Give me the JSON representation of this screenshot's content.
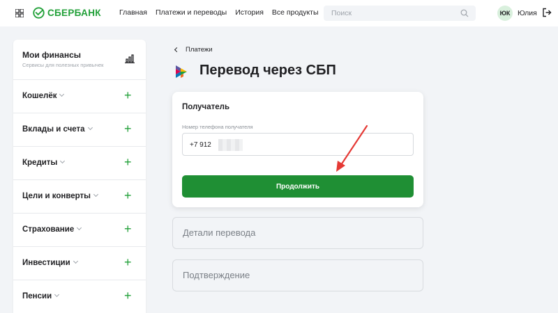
{
  "header": {
    "logo_text": "СБЕРБАНК",
    "nav": [
      "Главная",
      "Платежи и переводы",
      "История",
      "Все продукты"
    ],
    "search_placeholder": "Поиск",
    "avatar_initials": "ЮК",
    "username": "Юлия"
  },
  "sidebar": {
    "title": "Мои финансы",
    "subtitle": "Сервисы для полезных привычек",
    "items": [
      {
        "label": "Кошелёк"
      },
      {
        "label": "Вклады и счета"
      },
      {
        "label": "Кредиты"
      },
      {
        "label": "Цели и конверты"
      },
      {
        "label": "Страхование"
      },
      {
        "label": "Инвестиции"
      },
      {
        "label": "Пенсии"
      }
    ]
  },
  "main": {
    "breadcrumb": "Платежи",
    "title": "Перевод через СБП",
    "recipient_card": {
      "title": "Получатель",
      "field_label": "Номер телефона получателя",
      "phone_value": "+7 912",
      "button_label": "Продолжить"
    },
    "steps": [
      "Детали перевода",
      "Подтверждение"
    ]
  },
  "colors": {
    "brand_green": "#21a038",
    "button_green": "#1f8f34",
    "arrow_red": "#e53935"
  }
}
